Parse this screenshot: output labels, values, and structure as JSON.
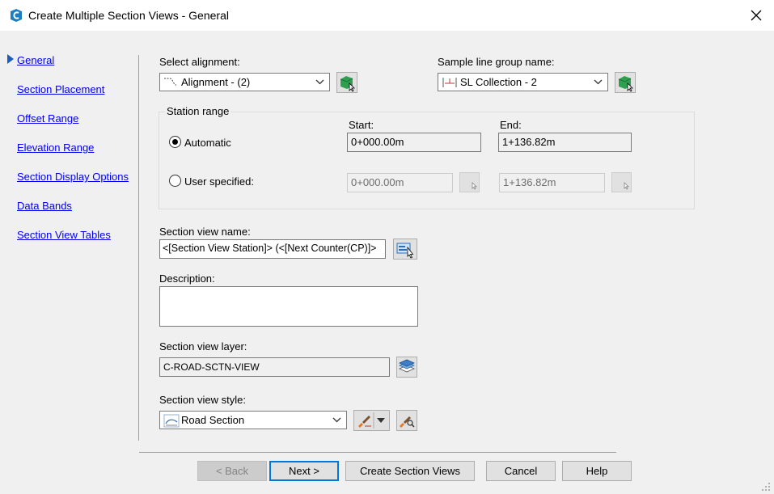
{
  "window": {
    "title": "Create Multiple Section Views - General"
  },
  "nav": {
    "items": [
      "General",
      "Section Placement",
      "Offset Range",
      "Elevation Range",
      "Section Display Options",
      "Data Bands",
      "Section View Tables"
    ],
    "active": "General"
  },
  "alignment": {
    "label": "Select alignment:",
    "value": "Alignment - (2)"
  },
  "sample_line_group": {
    "label": "Sample line group name:",
    "value": "SL Collection - 2"
  },
  "station_range": {
    "title": "Station range",
    "start_label": "Start:",
    "end_label": "End:",
    "automatic_label": "Automatic",
    "automatic_start": "0+000.00m",
    "automatic_end": "1+136.82m",
    "user_label": "User specified:",
    "user_start": "0+000.00m",
    "user_end": "1+136.82m",
    "selected": "Automatic"
  },
  "section_view_name": {
    "label": "Section view name:",
    "value": "<[Section View Station]> (<[Next Counter(CP)]>"
  },
  "description": {
    "label": "Description:",
    "value": ""
  },
  "section_view_layer": {
    "label": "Section view layer:",
    "value": "C-ROAD-SCTN-VIEW"
  },
  "section_view_style": {
    "label": "Section view style:",
    "value": "Road Section"
  },
  "buttons": {
    "back": "< Back",
    "next": "Next >",
    "create": "Create Section Views",
    "cancel": "Cancel",
    "help": "Help"
  },
  "colors": {
    "link": "#0000ee",
    "accent": "#0078d7",
    "pick_green": "#2e9e4f"
  }
}
